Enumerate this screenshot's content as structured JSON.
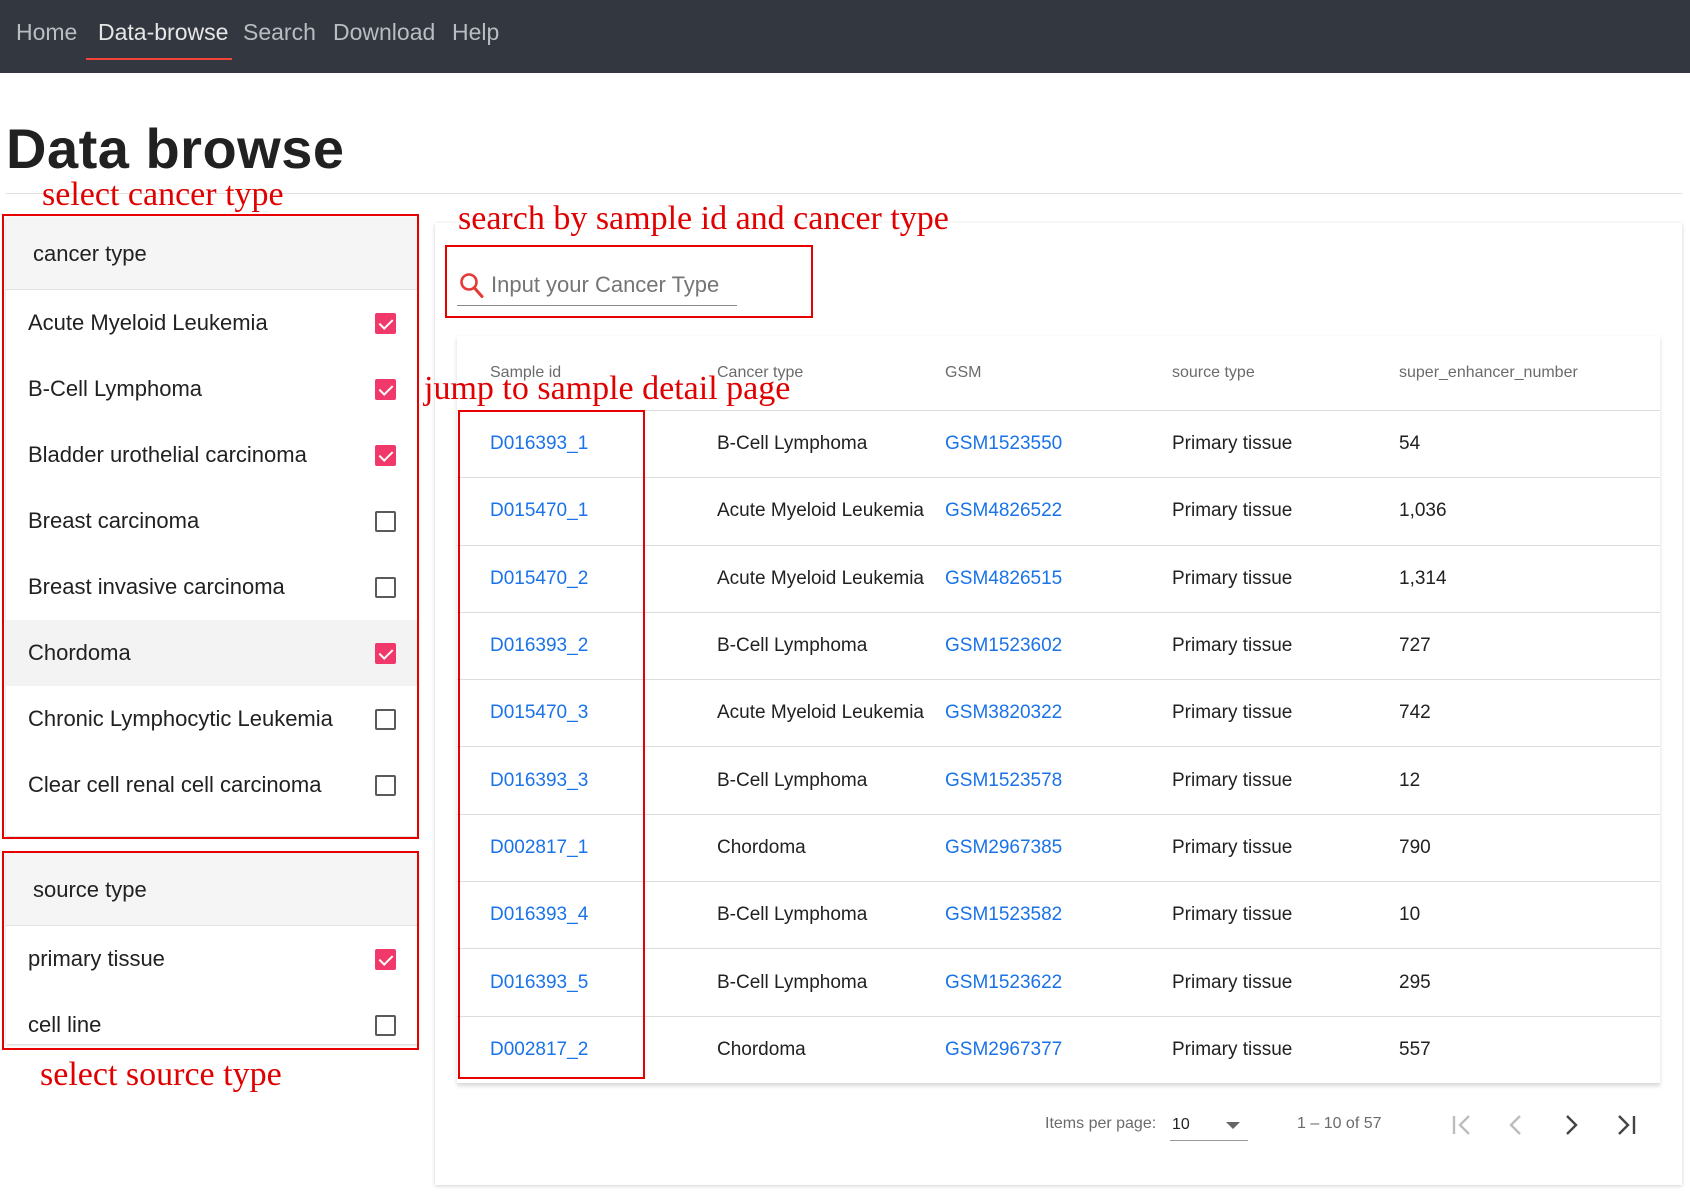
{
  "nav": {
    "items": [
      {
        "label": "Home"
      },
      {
        "label": "Data-browse"
      },
      {
        "label": "Search"
      },
      {
        "label": "Download"
      },
      {
        "label": "Help"
      }
    ],
    "active": "Data-browse"
  },
  "page": {
    "title": "Data browse"
  },
  "annotations": {
    "select_cancer_type": "select cancer type",
    "search_hint": "search by sample id and cancer type",
    "jump_hint": "jump to sample detail page",
    "select_source_type": "select source type"
  },
  "filters": {
    "cancer_type": {
      "header": "cancer type",
      "options": [
        {
          "label": "Acute Myeloid Leukemia",
          "checked": true
        },
        {
          "label": "B-Cell Lymphoma",
          "checked": true
        },
        {
          "label": "Bladder urothelial carcinoma",
          "checked": true
        },
        {
          "label": "Breast carcinoma",
          "checked": false
        },
        {
          "label": "Breast invasive carcinoma",
          "checked": false
        },
        {
          "label": "Chordoma",
          "checked": true
        },
        {
          "label": "Chronic Lymphocytic Leukemia",
          "checked": false
        },
        {
          "label": "Clear cell renal cell carcinoma",
          "checked": false
        }
      ]
    },
    "source_type": {
      "header": "source type",
      "options": [
        {
          "label": "primary tissue",
          "checked": true
        },
        {
          "label": "cell line",
          "checked": false
        }
      ]
    }
  },
  "search": {
    "placeholder": "Input your Cancer Type",
    "value": ""
  },
  "table": {
    "columns": [
      "Sample id",
      "Cancer type",
      "GSM",
      "source type",
      "super_enhancer_number"
    ],
    "rows": [
      [
        "D016393_1",
        "B-Cell Lymphoma",
        "GSM1523550",
        "Primary tissue",
        "54"
      ],
      [
        "D015470_1",
        "Acute Myeloid Leukemia",
        "GSM4826522",
        "Primary tissue",
        "1,036"
      ],
      [
        "D015470_2",
        "Acute Myeloid Leukemia",
        "GSM4826515",
        "Primary tissue",
        "1,314"
      ],
      [
        "D016393_2",
        "B-Cell Lymphoma",
        "GSM1523602",
        "Primary tissue",
        "727"
      ],
      [
        "D015470_3",
        "Acute Myeloid Leukemia",
        "GSM3820322",
        "Primary tissue",
        "742"
      ],
      [
        "D016393_3",
        "B-Cell Lymphoma",
        "GSM1523578",
        "Primary tissue",
        "12"
      ],
      [
        "D002817_1",
        "Chordoma",
        "GSM2967385",
        "Primary tissue",
        "790"
      ],
      [
        "D016393_4",
        "B-Cell Lymphoma",
        "GSM1523582",
        "Primary tissue",
        "10"
      ],
      [
        "D016393_5",
        "B-Cell Lymphoma",
        "GSM1523622",
        "Primary tissue",
        "295"
      ],
      [
        "D002817_2",
        "Chordoma",
        "GSM2967377",
        "Primary tissue",
        "557"
      ]
    ]
  },
  "paginator": {
    "items_per_page_label": "Items per page:",
    "page_size": "10",
    "range_label": "1 – 10 of 57"
  },
  "colors": {
    "nav_bg": "#333840",
    "accent_checkbox": "#f0386b",
    "link": "#1a73e8",
    "annotation": "#e00000",
    "nav_underline": "#f44336"
  },
  "icons": [
    "search-icon",
    "first-page-icon",
    "prev-page-icon",
    "next-page-icon",
    "last-page-icon",
    "dropdown-caret-icon",
    "checkbox-icon"
  ]
}
